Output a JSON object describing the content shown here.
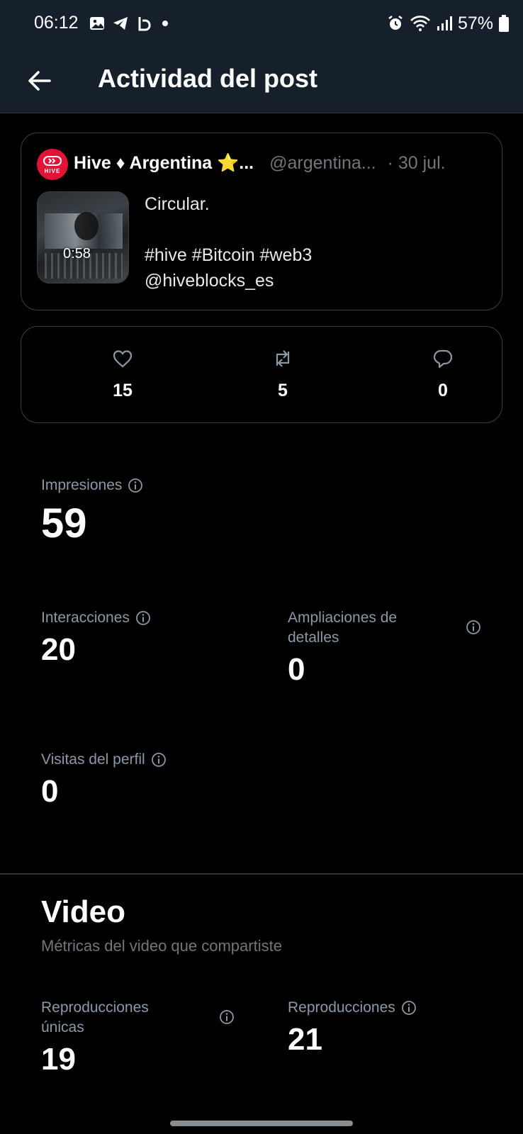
{
  "status_bar": {
    "time": "06:12",
    "battery": "57%",
    "icons_left": [
      "image-icon",
      "telegram-icon",
      "app-icon",
      "dot-icon"
    ],
    "icons_right": [
      "alarm-icon",
      "wifi-icon",
      "signal-icon",
      "battery-icon"
    ]
  },
  "header": {
    "title": "Actividad del post"
  },
  "post": {
    "name": "Hive ♦ Argentina ⭐...",
    "handle": "@argentina...",
    "date": "· 30 jul.",
    "video_duration": "0:58",
    "text_lines": [
      "Circular.",
      "",
      "#hive #Bitcoin #web3",
      "@hiveblocks_es"
    ],
    "avatar_text": "HIVE"
  },
  "engagement": {
    "likes": "15",
    "reposts": "5",
    "replies": "0"
  },
  "metrics": {
    "impressions": {
      "label": "Impresiones",
      "value": "59"
    },
    "interactions": {
      "label": "Interacciones",
      "value": "20"
    },
    "detail_expands": {
      "label_line1": "Ampliaciones de",
      "label_line2": "detalles",
      "value": "0"
    },
    "profile_visits": {
      "label": "Visitas del perfil",
      "value": "0"
    }
  },
  "video_section": {
    "title": "Video",
    "subtitle": "Métricas del video que compartiste",
    "unique_plays": {
      "label_line1": "Reproducciones",
      "label_line2": "únicas",
      "value": "19"
    },
    "plays": {
      "label": "Reproducciones",
      "value": "21"
    }
  },
  "colors": {
    "background": "#000000",
    "header_bg": "#15202b",
    "secondary_text": "#8b98a5",
    "hive_red": "#e31337"
  }
}
